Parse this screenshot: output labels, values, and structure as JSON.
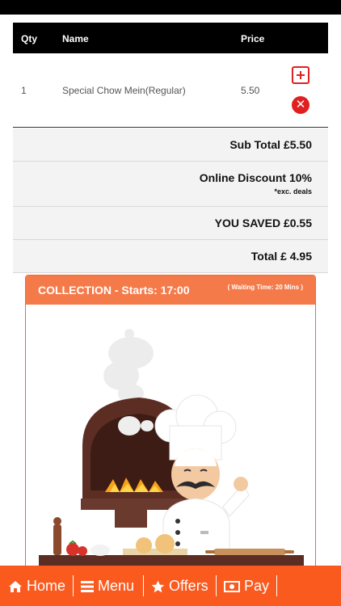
{
  "table": {
    "headers": {
      "qty": "Qty",
      "name": "Name",
      "price": "Price"
    },
    "rows": [
      {
        "qty": "1",
        "name": "Special Chow Mein(Regular)",
        "price": "5.50"
      }
    ]
  },
  "summary": {
    "subtotal": "Sub Total £5.50",
    "discount": "Online Discount 10%",
    "discount_note": "*exc. deals",
    "saved": "YOU SAVED £0.55",
    "total": "Total £ 4.95"
  },
  "collection": {
    "title": "COLLECTION - Starts: 17:00",
    "waiting": "( Waiting Time: 20 Mins )"
  },
  "nav": {
    "home": "Home",
    "menu": "Menu",
    "offers": "Offers",
    "pay": "Pay"
  },
  "colors": {
    "accent": "#fb5a1e",
    "panel_header": "#f57a4a",
    "danger": "#e02020"
  },
  "icons": [
    "plus-square-icon",
    "remove-circle-icon",
    "home-icon",
    "menu-bars-icon",
    "star-icon",
    "money-icon"
  ]
}
